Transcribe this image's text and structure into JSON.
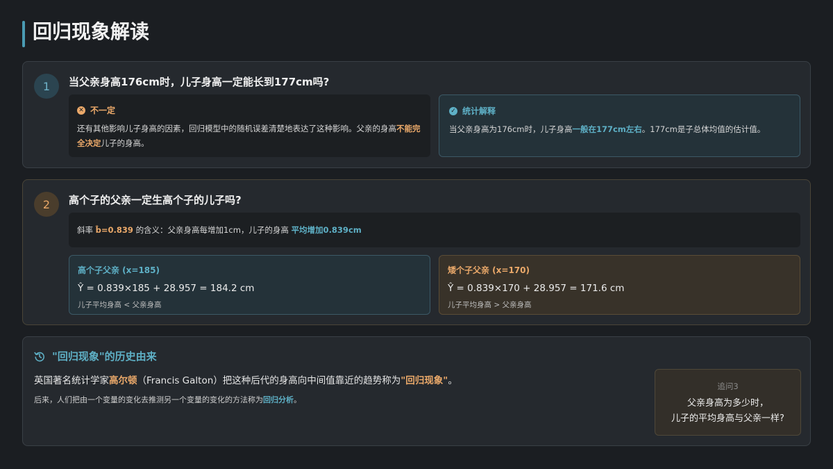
{
  "page_title": "回归现象解读",
  "q1": {
    "number": "1",
    "question": "当父亲身高176cm时，儿子身高一定能长到177cm吗?",
    "left": {
      "icon": "x-circle-icon",
      "heading": "不一定",
      "text_1": "还有其他影响儿子身高的因素，回归模型中的随机误差清楚地表达了这种影响。父亲的身高",
      "highlight": "不能完全决定",
      "text_2": "儿子的身高。"
    },
    "right": {
      "icon": "check-circle-icon",
      "heading": "统计解释",
      "text_1": "当父亲身高为176cm时，儿子身高",
      "highlight": "一般在177cm左右",
      "text_2": "。177cm是子总体均值的估计值。"
    }
  },
  "q2": {
    "number": "2",
    "question": "高个子的父亲一定生高个子的儿子吗?",
    "slope_prefix": "斜率",
    "slope_value": "b̂=0.839",
    "slope_middle": "的含义：父亲身高每增加1cm，儿子的身高",
    "slope_highlight": "平均增加0.839cm",
    "tall": {
      "title": "高个子父亲 (x=185)",
      "formula": "Ŷ = 0.839×185 + 28.957 = 184.2 cm",
      "note": "儿子平均身高 < 父亲身高"
    },
    "short": {
      "title": "矮个子父亲 (x=170)",
      "formula": "Ŷ = 0.839×170 + 28.957 = 171.6 cm",
      "note": "儿子平均身高 > 父亲身高"
    }
  },
  "history": {
    "icon": "history-icon",
    "heading": "\"回归现象\"的历史由来",
    "p1_1": "英国著名统计学家",
    "p1_name": "高尔顿",
    "p1_2": "（Francis Galton）把这种后代的身高向中间值靠近的趋势称为",
    "p1_term": "\"回归现象\"",
    "p1_3": "。",
    "p2_1": "后来，人们把由一个变量的变化去推测另一个变量的变化的方法称为",
    "p2_term": "回归分析",
    "p2_2": "。"
  },
  "followup": {
    "label": "追问3",
    "line1": "父亲身高为多少时，",
    "line2": "儿子的平均身高与父亲一样?"
  },
  "colors": {
    "accent_blue": "#5eb0c6",
    "accent_orange": "#eba96a",
    "background": "#1b1e22"
  }
}
